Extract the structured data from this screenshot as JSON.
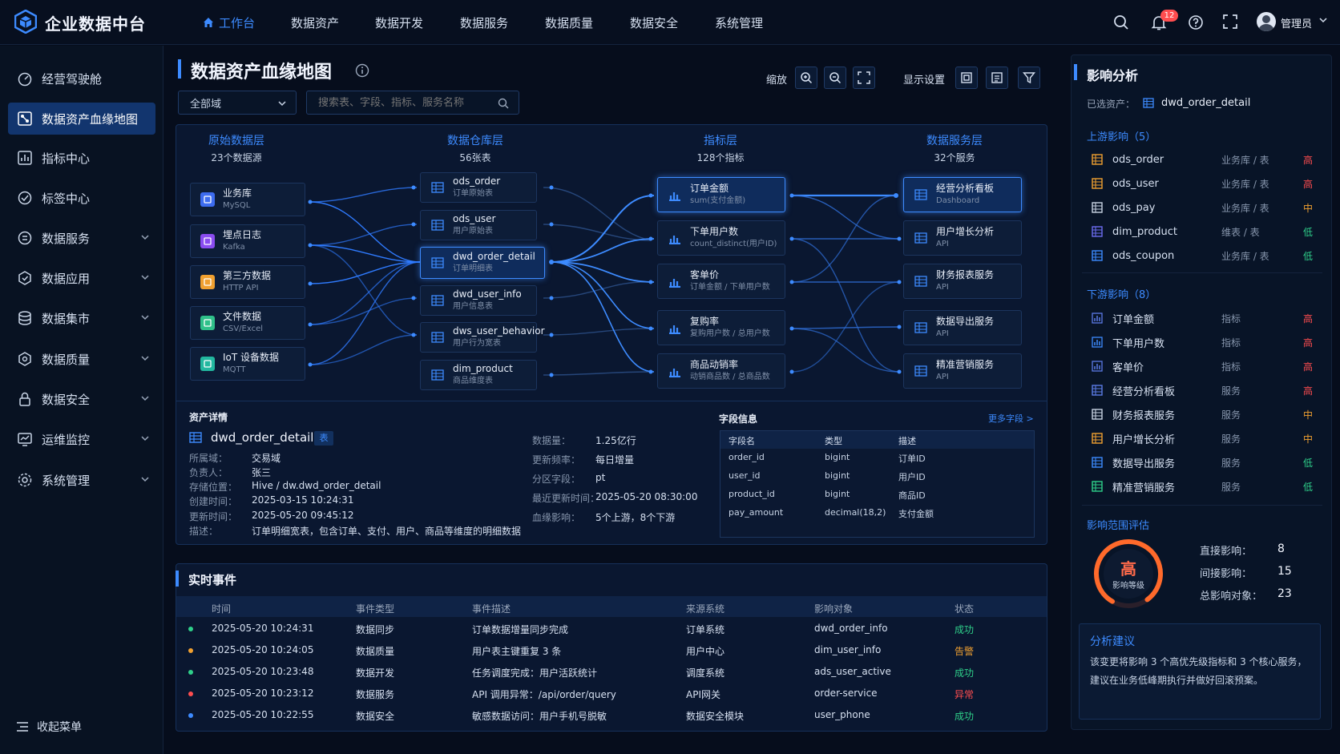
{
  "app": {
    "brand": "企业数据中台"
  },
  "topnav": [
    "工作台",
    "数据资产",
    "数据开发",
    "数据服务",
    "数据质量",
    "数据安全",
    "系统管理"
  ],
  "header": {
    "notif_count": "12",
    "user": "管理员"
  },
  "sidebar": {
    "items": [
      {
        "label": "经营驾驶舱",
        "icon": "dashboard-icon"
      },
      {
        "label": "数据资产血缘地图",
        "icon": "lineage-map-icon"
      },
      {
        "label": "指标中心",
        "icon": "metrics-icon"
      },
      {
        "label": "标签中心",
        "icon": "tag-icon"
      },
      {
        "label": "数据服务",
        "icon": "service-icon"
      },
      {
        "label": "数据应用",
        "icon": "app-icon"
      },
      {
        "label": "数据集市",
        "icon": "database-icon"
      },
      {
        "label": "数据质量",
        "icon": "quality-icon"
      },
      {
        "label": "数据安全",
        "icon": "lock-icon"
      },
      {
        "label": "运维监控",
        "icon": "monitor-icon"
      },
      {
        "label": "系统管理",
        "icon": "gear-icon"
      }
    ],
    "collapse": "收起菜单"
  },
  "main": {
    "title": "数据资产血缘地图",
    "zoom_label": "缩放",
    "display_label": "显示设置",
    "domain_select": "全部域",
    "search_placeholder": "搜索表、字段、指标、服务名称",
    "columns": [
      {
        "title": "原始数据层",
        "sub": "23个数据源"
      },
      {
        "title": "数据仓库层",
        "sub": "56张表"
      },
      {
        "title": "指标层",
        "sub": "128个指标"
      },
      {
        "title": "数据服务层",
        "sub": "32个服务"
      }
    ],
    "sources": [
      {
        "name": "业务库",
        "sub": "MySQL",
        "color": "#3d6cf0"
      },
      {
        "name": "埋点日志",
        "sub": "Kafka",
        "color": "#8a4cf0"
      },
      {
        "name": "第三方数据",
        "sub": "HTTP API",
        "color": "#f0a030"
      },
      {
        "name": "文件数据",
        "sub": "CSV/Excel",
        "color": "#2fc08a"
      },
      {
        "name": "IoT 设备数据",
        "sub": "MQTT",
        "color": "#22b8a0"
      }
    ],
    "warehouse": [
      {
        "name": "ods_order",
        "sub": "订单原始表"
      },
      {
        "name": "ods_user",
        "sub": "用户原始表"
      },
      {
        "name": "dwd_order_detail",
        "sub": "订单明细表"
      },
      {
        "name": "dwd_user_info",
        "sub": "用户信息表"
      },
      {
        "name": "dws_user_behavior",
        "sub": "用户行为宽表"
      },
      {
        "name": "dim_product",
        "sub": "商品维度表"
      }
    ],
    "metrics": [
      {
        "name": "订单金额",
        "sub": "sum(支付金额)"
      },
      {
        "name": "下单用户数",
        "sub": "count_distinct(用户ID)"
      },
      {
        "name": "客单价",
        "sub": "订单金额 / 下单用户数"
      },
      {
        "name": "复购率",
        "sub": "复购用户数 / 总用户数"
      },
      {
        "name": "商品动销率",
        "sub": "动销商品数 / 总商品数"
      }
    ],
    "services": [
      {
        "name": "经营分析看板",
        "sub": "Dashboard"
      },
      {
        "name": "用户增长分析",
        "sub": "API"
      },
      {
        "name": "财务报表服务",
        "sub": "API"
      },
      {
        "name": "数据导出服务",
        "sub": "API"
      },
      {
        "name": "精准营销服务",
        "sub": "API"
      }
    ],
    "detail": {
      "title": "资产详情",
      "name": "dwd_order_detail",
      "tag": "表",
      "left": [
        [
          "所属域：",
          "交易域"
        ],
        [
          "负责人：",
          "张三"
        ],
        [
          "存储位置：",
          "Hive / dw.dwd_order_detail"
        ],
        [
          "创建时间：",
          "2025-03-15 10:24:31"
        ],
        [
          "更新时间：",
          "2025-05-20 09:45:12"
        ],
        [
          "描述：",
          "订单明细宽表，包含订单、支付、用户、商品等维度的明细数据"
        ]
      ],
      "right": [
        [
          "数据量：",
          "1.25亿行"
        ],
        [
          "更新频率：",
          "每日增量"
        ],
        [
          "分区字段：",
          "pt"
        ],
        [
          "最近更新时间：",
          "2025-05-20 08:30:00"
        ],
        [
          "血缘影响：",
          "5个上游，8个下游"
        ]
      ]
    },
    "fields": {
      "title": "字段信息",
      "more": "更多字段 >",
      "headers": [
        "字段名",
        "类型",
        "描述"
      ],
      "rows": [
        [
          "order_id",
          "bigint",
          "订单ID"
        ],
        [
          "user_id",
          "bigint",
          "用户ID"
        ],
        [
          "product_id",
          "bigint",
          "商品ID"
        ],
        [
          "pay_amount",
          "decimal(18,2)",
          "支付金额"
        ]
      ]
    }
  },
  "events": {
    "title": "实时事件",
    "headers": [
      "时间",
      "事件类型",
      "事件描述",
      "来源系统",
      "影响对象",
      "状态"
    ],
    "rows": [
      {
        "dot": "#2fd08a",
        "time": "2025-05-20 10:24:31",
        "type": "数据同步",
        "desc": "订单数据增量同步完成",
        "src": "订单系统",
        "obj": "dwd_order_info",
        "status": "成功",
        "sc": "#2fd08a"
      },
      {
        "dot": "#f0a030",
        "time": "2025-05-20 10:24:05",
        "type": "数据质量",
        "desc": "用户表主键重复 3 条",
        "src": "用户中心",
        "obj": "dim_user_info",
        "status": "告警",
        "sc": "#f0a030"
      },
      {
        "dot": "#2fd08a",
        "time": "2025-05-20 10:23:48",
        "type": "数据开发",
        "desc": "任务调度完成：用户活跃统计",
        "src": "调度系统",
        "obj": "ads_user_active",
        "status": "成功",
        "sc": "#2fd08a"
      },
      {
        "dot": "#ff4d4f",
        "time": "2025-05-20 10:23:12",
        "type": "数据服务",
        "desc": "API 调用异常：/api/order/query",
        "src": "API网关",
        "obj": "order-service",
        "status": "异常",
        "sc": "#ff4d4f"
      },
      {
        "dot": "#3d8bff",
        "time": "2025-05-20 10:22:55",
        "type": "数据安全",
        "desc": "敏感数据访问：用户手机号脱敏",
        "src": "数据安全模块",
        "obj": "user_phone",
        "status": "成功",
        "sc": "#2fd08a"
      }
    ]
  },
  "impact": {
    "title": "影响分析",
    "selected_label": "已选资产：",
    "selected": "dwd_order_detail",
    "upstream_title": "上游影响（5）",
    "upstream": [
      {
        "name": "ods_order",
        "type": "业务库 / 表",
        "level": "高",
        "lc": "#ff4d4f",
        "ic": "#f0a030"
      },
      {
        "name": "ods_user",
        "type": "业务库 / 表",
        "level": "高",
        "lc": "#ff4d4f",
        "ic": "#f0a030"
      },
      {
        "name": "ods_pay",
        "type": "业务库 / 表",
        "level": "中",
        "lc": "#f0a030",
        "ic": "#c9d3e3"
      },
      {
        "name": "dim_product",
        "type": "维表 / 表",
        "level": "低",
        "lc": "#2fd08a",
        "ic": "#6c6cf0"
      },
      {
        "name": "ods_coupon",
        "type": "业务库 / 表",
        "level": "低",
        "lc": "#2fd08a",
        "ic": "#3d8bff"
      }
    ],
    "downstream_title": "下游影响（8）",
    "downstream": [
      {
        "name": "订单金额",
        "type": "指标",
        "level": "高",
        "lc": "#ff4d4f",
        "ic": "#5b7be6"
      },
      {
        "name": "下单用户数",
        "type": "指标",
        "level": "高",
        "lc": "#ff4d4f",
        "ic": "#3d8bff"
      },
      {
        "name": "客单价",
        "type": "指标",
        "level": "高",
        "lc": "#ff4d4f",
        "ic": "#5b7be6"
      },
      {
        "name": "经营分析看板",
        "type": "服务",
        "level": "高",
        "lc": "#ff4d4f",
        "ic": "#5b7be6"
      },
      {
        "name": "财务报表服务",
        "type": "服务",
        "level": "中",
        "lc": "#f0a030",
        "ic": "#c9d3e3"
      },
      {
        "name": "用户增长分析",
        "type": "服务",
        "level": "中",
        "lc": "#f0a030",
        "ic": "#f0a030"
      },
      {
        "name": "数据导出服务",
        "type": "服务",
        "level": "低",
        "lc": "#2fd08a",
        "ic": "#3d8bff"
      },
      {
        "name": "精准营销服务",
        "type": "服务",
        "level": "低",
        "lc": "#2fd08a",
        "ic": "#2fd08a"
      }
    ],
    "scope_title": "影响范围评估",
    "gauge_level": "高",
    "gauge_label": "影响等级",
    "stats": [
      [
        "直接影响：",
        "8"
      ],
      [
        "间接影响：",
        "15"
      ],
      [
        "总影响对象：",
        "23"
      ]
    ],
    "advice_title": "分析建议",
    "advice": "该变更将影响 3 个高优先级指标和 3 个核心服务，建议在业务低峰期执行并做好回滚预案。"
  }
}
